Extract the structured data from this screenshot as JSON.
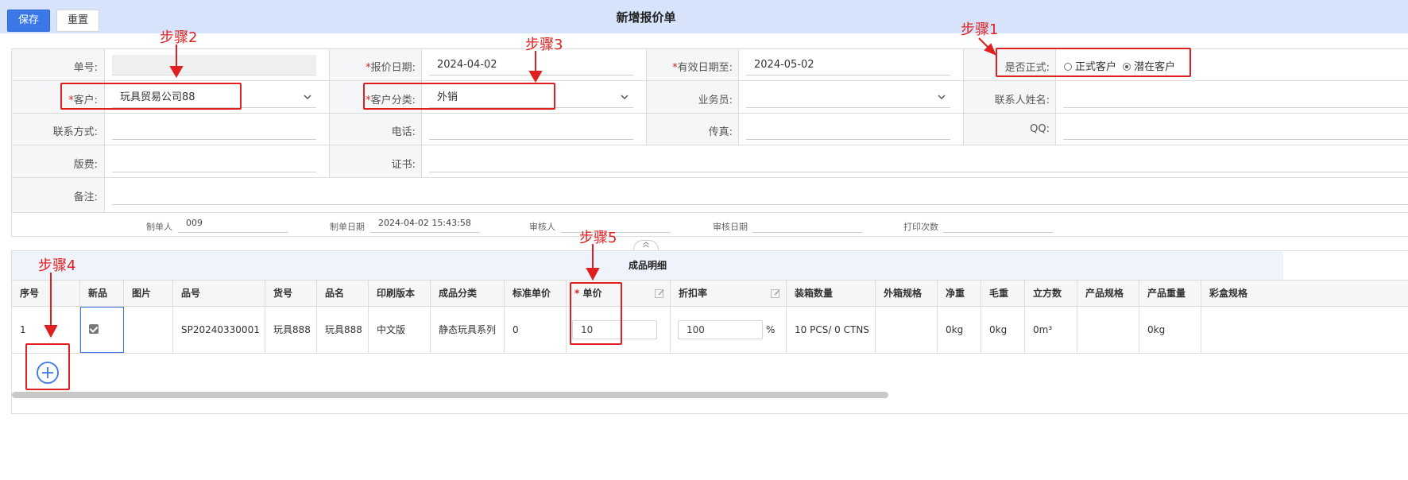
{
  "toolbar": {
    "save_label": "保存",
    "reset_label": "重置"
  },
  "page_title": "新增报价单",
  "form": {
    "row1": {
      "order_no_label": "单号:",
      "quote_date_label": "报价日期:",
      "quote_date_value": "2024-04-02",
      "valid_until_label": "有效日期至:",
      "valid_until_value": "2024-05-02",
      "is_formal_label": "是否正式:",
      "radio_formal": "正式客户",
      "radio_potential": "潜在客户"
    },
    "row2": {
      "customer_label": "客户:",
      "customer_value": "玩具贸易公司88",
      "customer_category_label": "客户分类:",
      "customer_category_value": "外销",
      "salesman_label": "业务员:",
      "contact_name_label": "联系人姓名:"
    },
    "row3": {
      "contact_label": "联系方式:",
      "phone_label": "电话:",
      "fax_label": "传真:",
      "qq_label": "QQ:"
    },
    "row4": {
      "sample_fee_label": "版费:",
      "certificate_label": "证书:"
    },
    "row5": {
      "remark_label": "备注:"
    },
    "meta": {
      "creator_label": "制单人",
      "creator_value": "009",
      "created_date_label": "制单日期",
      "created_date_value": "2024-04-02 15:43:58",
      "auditor_label": "审核人",
      "audit_date_label": "审核日期",
      "print_count_label": "打印次数"
    }
  },
  "detail": {
    "title": "成品明细",
    "headers": [
      "序号",
      "新品",
      "图片",
      "品号",
      "货号",
      "品名",
      "印刷版本",
      "成品分类",
      "标准单价",
      "单价",
      "折扣率",
      "装箱数量",
      "外箱规格",
      "净重",
      "毛重",
      "立方数",
      "产品规格",
      "产品重量",
      "彩盒规格"
    ],
    "row": {
      "index": "1",
      "new_item_checked": true,
      "item_no": "SP20240330001",
      "goods_no": "玩具888",
      "name": "玩具888",
      "print_version": "中文版",
      "category": "静态玩具系列",
      "std_price": "0",
      "price": "10",
      "discount": "100",
      "discount_unit": "%",
      "packing_qty": "10 PCS/ 0 CTNS",
      "net_weight": "0kg",
      "gross_weight": "0kg",
      "volume": "0m³",
      "product_weight": "0kg"
    }
  },
  "annotations": [
    "步骤1",
    "步骤2",
    "步骤3",
    "步骤4",
    "步骤5"
  ],
  "colors": {
    "accent": "#3a78e8",
    "annotation": "#e02020",
    "topbar": "#d7e3fb"
  }
}
